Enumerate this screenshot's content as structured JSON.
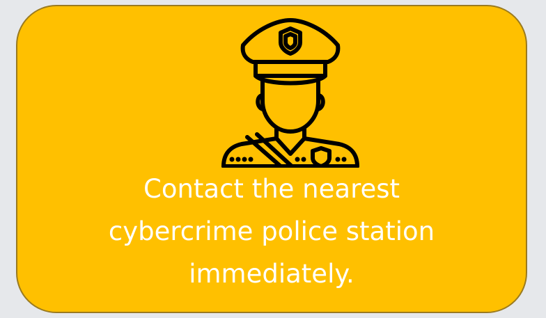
{
  "card": {
    "background_color": "#ffc000",
    "border_color": "#9a7a1f",
    "icon": "police-officer-icon",
    "message_lines": [
      "Contact the nearest",
      "cybercrime police station",
      "immediately."
    ],
    "text_color": "#ffffff"
  }
}
